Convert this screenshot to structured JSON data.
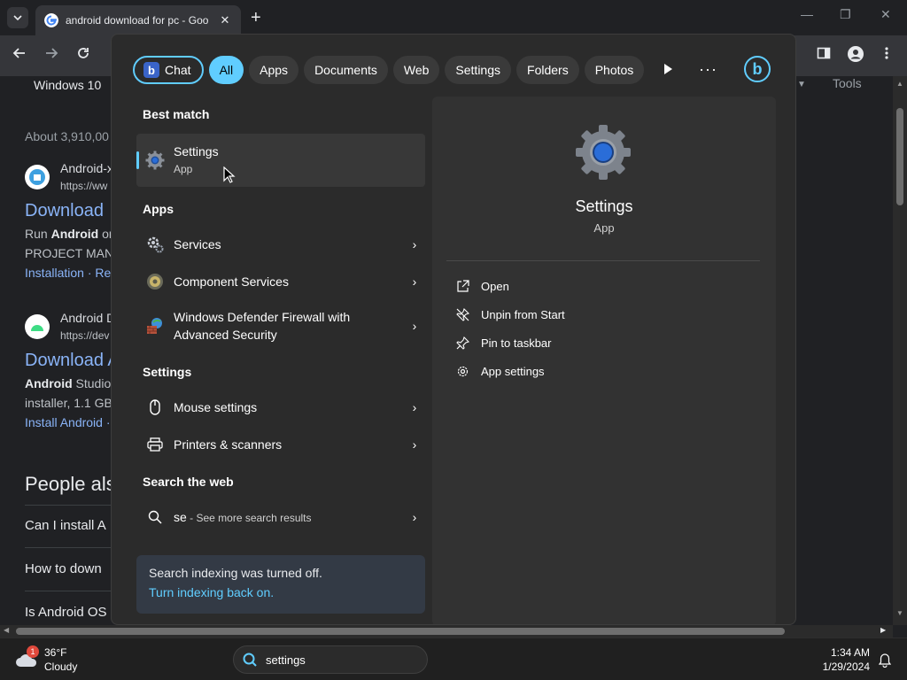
{
  "browser": {
    "tab_title": "android download for pc - Goo",
    "tab_close": "✕",
    "new_tab": "+",
    "minimize": "—",
    "restore": "❐",
    "close": "✕"
  },
  "page": {
    "filter_chip": "Windows 10",
    "tools": "Tools",
    "result_count": "About 3,910,00",
    "results": [
      {
        "site": "Android-x",
        "url": "https://ww",
        "title": "Download",
        "snippet_bold": "Android",
        "snippet_pre": "Run ",
        "snippet_post": " on",
        "snippet2": "PROJECT MANA",
        "links": "Installation · Re"
      },
      {
        "site": "Android D",
        "url": "https://dev",
        "title": "Download A",
        "snippet_bold": "Android",
        "snippet_post": " Studio",
        "snippet2": "installer, 1.1 GB",
        "links": "Install Android ·"
      }
    ],
    "people_also": "People als",
    "questions": [
      "Can I install A",
      "How to down",
      "Is Android OS"
    ]
  },
  "search_panel": {
    "filters": [
      {
        "label": "Chat",
        "kind": "chat"
      },
      {
        "label": "All",
        "kind": "active"
      },
      {
        "label": "Apps",
        "kind": "normal"
      },
      {
        "label": "Documents",
        "kind": "normal"
      },
      {
        "label": "Web",
        "kind": "normal"
      },
      {
        "label": "Settings",
        "kind": "normal"
      },
      {
        "label": "Folders",
        "kind": "normal"
      },
      {
        "label": "Photos",
        "kind": "normal"
      }
    ],
    "more": "···",
    "best_match_title": "Best match",
    "best_match": {
      "name": "Settings",
      "type": "App"
    },
    "apps_title": "Apps",
    "apps": [
      {
        "name": "Services"
      },
      {
        "name": "Component Services"
      },
      {
        "name": "Windows Defender Firewall with Advanced Security"
      }
    ],
    "settings_title": "Settings",
    "settings": [
      {
        "name": "Mouse settings"
      },
      {
        "name": "Printers & scanners"
      }
    ],
    "web_title": "Search the web",
    "web": {
      "query": "se",
      "suffix": " - See more search results"
    },
    "notice": {
      "text": "Search indexing was turned off.",
      "link": "Turn indexing back on."
    },
    "preview": {
      "name": "Settings",
      "type": "App",
      "actions": [
        {
          "label": "Open",
          "icon": "open-icon"
        },
        {
          "label": "Unpin from Start",
          "icon": "unpin-icon"
        },
        {
          "label": "Pin to taskbar",
          "icon": "pin-icon"
        },
        {
          "label": "App settings",
          "icon": "gear-icon"
        }
      ]
    },
    "accent": "#60cdff"
  },
  "taskbar": {
    "weather_badge": "1",
    "temperature": "36°F",
    "condition": "Cloudy",
    "search_value": "settings",
    "time": "1:34 AM",
    "date": "1/29/2024"
  }
}
